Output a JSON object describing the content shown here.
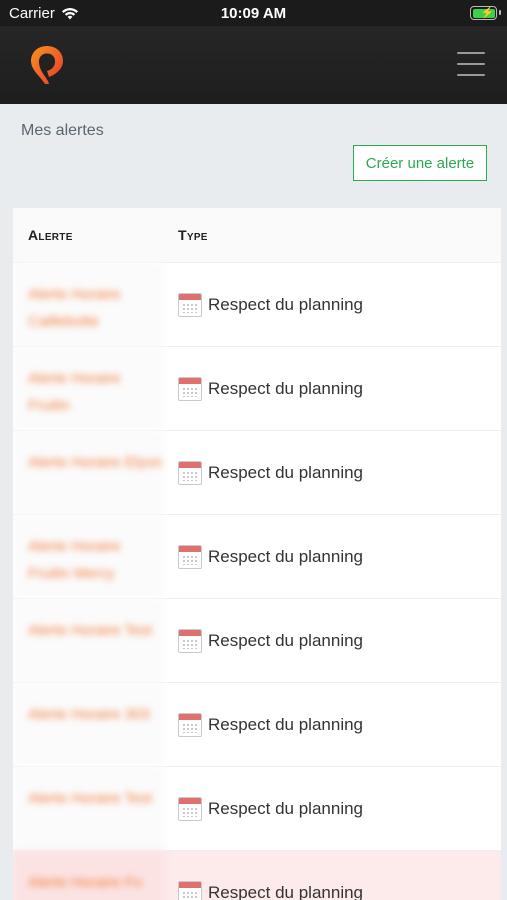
{
  "status_bar": {
    "carrier": "Carrier",
    "time": "10:09 AM"
  },
  "header": {
    "logo_icon": "map-pin-logo",
    "menu_icon": "hamburger-menu-icon"
  },
  "page": {
    "title": "Mes alertes",
    "create_button": "Créer une alerte"
  },
  "table": {
    "columns": [
      "Alerte",
      "Type"
    ],
    "rows": [
      {
        "alert": "Alerte Horaire Caillebotte",
        "type": "Respect du planning"
      },
      {
        "alert": "Alerte Horaire Fruitin",
        "type": "Respect du planning"
      },
      {
        "alert": "Alerte Horaire Elyon",
        "type": "Respect du planning"
      },
      {
        "alert": "Alerte Horaire Fruitin Mercy",
        "type": "Respect du planning"
      },
      {
        "alert": "Alerte Horaire Test",
        "type": "Respect du planning"
      },
      {
        "alert": "Alerte Horaire 303",
        "type": "Respect du planning"
      },
      {
        "alert": "Alerte Horaire Test",
        "type": "Respect du planning"
      },
      {
        "alert": "Alerte Horaire Fo",
        "type": "Respect du planning"
      }
    ]
  },
  "colors": {
    "accent_green": "#2eaa4e",
    "logo_orange": "#f26b2c",
    "logo_red": "#e8372f",
    "highlight_row": "#fdeaea"
  }
}
